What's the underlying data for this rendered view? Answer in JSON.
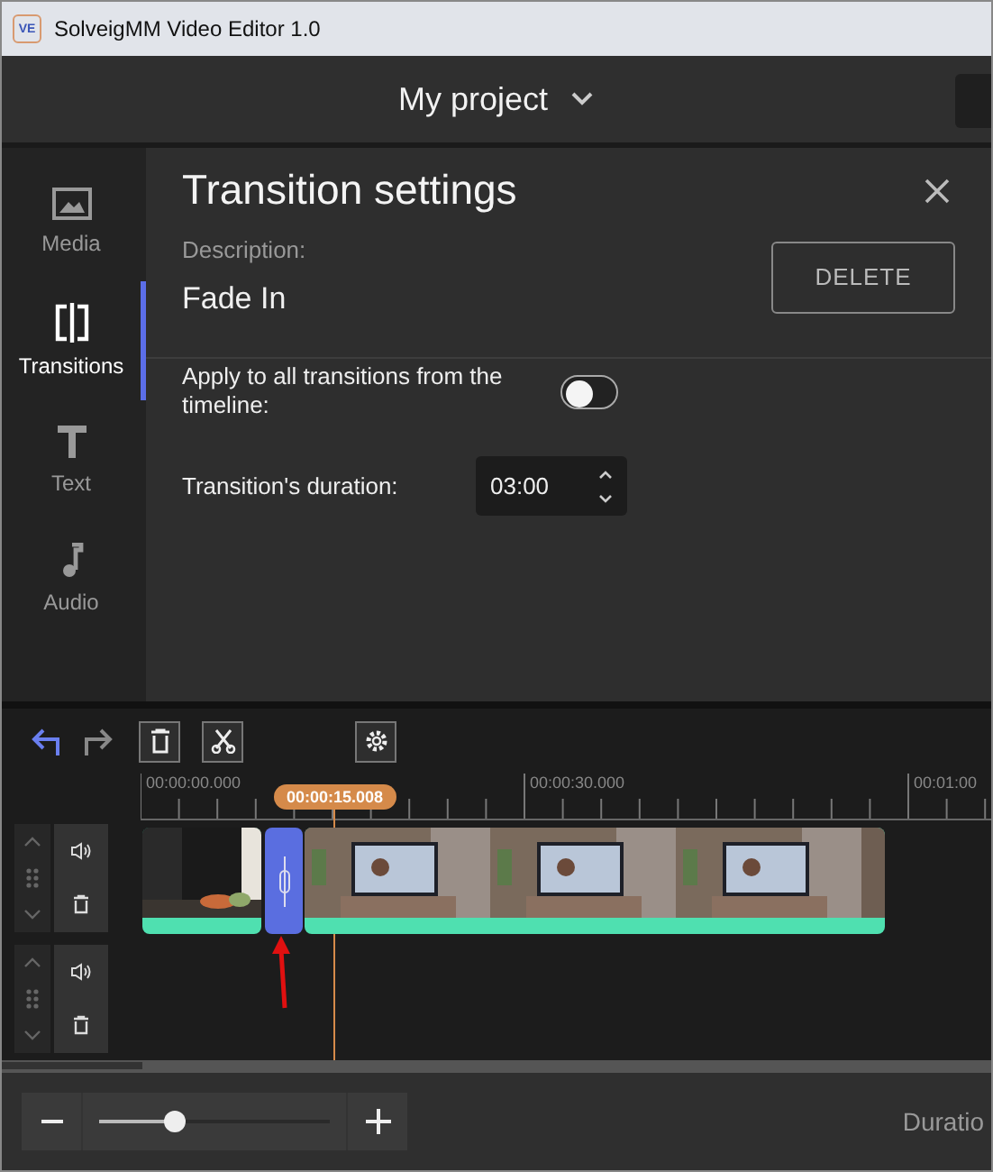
{
  "window": {
    "title": "SolveigMM Video Editor 1.0",
    "app_badge": "VE"
  },
  "header": {
    "project_title": "My project"
  },
  "sidebar": {
    "items": [
      {
        "kind": "media",
        "label": "Media",
        "selected": false
      },
      {
        "kind": "transitions",
        "label": "Transitions",
        "selected": true
      },
      {
        "kind": "text",
        "label": "Text",
        "selected": false
      },
      {
        "kind": "audio",
        "label": "Audio",
        "selected": false
      }
    ]
  },
  "panel": {
    "title": "Transition settings",
    "description_label": "Description:",
    "description": "Fade In",
    "delete_button": "DELETE",
    "apply_all": {
      "label": "Apply to all transitions from the timeline:",
      "on": false
    },
    "duration": {
      "label": "Transition's duration:",
      "value": "03:00"
    }
  },
  "timeline": {
    "ruler_labels": [
      "00:00:00.000",
      "00:00:30.000",
      "00:01:00"
    ],
    "playhead_time": "00:00:15.008",
    "tracks": [
      {
        "kind": "video"
      },
      {
        "kind": "empty"
      }
    ]
  },
  "zoom": {
    "level": 0.33
  },
  "status": {
    "duration_label": "Duratio"
  }
}
